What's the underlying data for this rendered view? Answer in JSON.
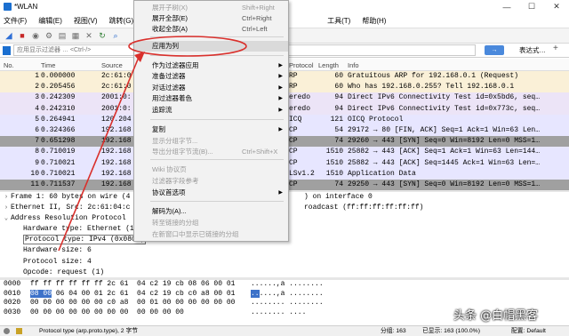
{
  "window": {
    "title": "*WLAN",
    "minimize": "—",
    "maximize": "☐",
    "close": "✕"
  },
  "menubar": [
    "文件(F)",
    "编辑(E)",
    "视图(V)",
    "跳转(G)",
    "工具(T)",
    "帮助(H)"
  ],
  "toolbar_icons": [
    "shark-fin-icon",
    "stop-icon",
    "restart-icon",
    "options-icon",
    "open-icon",
    "save-icon",
    "close-file-icon",
    "reload-icon",
    "search-icon"
  ],
  "filter": {
    "placeholder": "应用显示过滤器 … <Ctrl-/>",
    "expression_label": "表达式…",
    "plus": "+"
  },
  "packet_list": {
    "headers": {
      "no": "No.",
      "time": "Time",
      "source": "Source",
      "protocol": "Protocol",
      "length": "Length",
      "info": "Info"
    },
    "rows": [
      {
        "no": "1",
        "time": "0.000000",
        "src": "2c:61:0",
        "proto": "RP",
        "len": "60",
        "info": "Gratuitous ARP for 192.168.0.1 (Request)",
        "cls": "bg-arp"
      },
      {
        "no": "2",
        "time": "0.205456",
        "src": "2c:61:0",
        "proto": "RP",
        "len": "60",
        "info": "Who has 192.168.0.255? Tell 192.168.0.1",
        "cls": "bg-arp"
      },
      {
        "no": "3",
        "time": "0.242309",
        "src": "2001:0:",
        "proto": "eredo",
        "len": "94",
        "info": "Direct IPv6 Connectivity Test id=0x5bd6, seq…",
        "cls": "bg-teredo"
      },
      {
        "no": "4",
        "time": "0.242310",
        "src": "2001:0:",
        "proto": "eredo",
        "len": "94",
        "info": "Direct IPv6 Connectivity Test id=0x773c, seq…",
        "cls": "bg-teredo"
      },
      {
        "no": "5",
        "time": "0.264941",
        "src": "120.204",
        "proto": "ICQ",
        "len": "121",
        "info": "OICQ Protocol",
        "cls": "bg-oicq"
      },
      {
        "no": "6",
        "time": "0.324366",
        "src": "192.168",
        "proto": "CP",
        "len": "54",
        "info": "29172 → 80 [FIN, ACK] Seq=1 Ack=1 Win=63 Len…",
        "cls": "bg-tcp"
      },
      {
        "no": "7",
        "time": "0.651298",
        "src": "192.168",
        "proto": "CP",
        "len": "74",
        "info": "29260 → 443 [SYN] Seq=0 Win=8192 Len=0 MSS=1…",
        "cls": "bg-gray"
      },
      {
        "no": "8",
        "time": "0.710019",
        "src": "192.168",
        "proto": "CP",
        "len": "1510",
        "info": "25882 → 443 [ACK] Seq=1 Ack=1 Win=63 Len=144…",
        "cls": "bg-tcp"
      },
      {
        "no": "9",
        "time": "0.710021",
        "src": "192.168",
        "proto": "CP",
        "len": "1510",
        "info": "25882 → 443 [ACK] Seq=1445 Ack=1 Win=63 Len=…",
        "cls": "bg-tcp"
      },
      {
        "no": "10",
        "time": "0.710021",
        "src": "192.168",
        "proto": "LSv1.2",
        "len": "1510",
        "info": "Application Data",
        "cls": "bg-tcp"
      },
      {
        "no": "11",
        "time": "0.711537",
        "src": "192.168",
        "proto": "CP",
        "len": "74",
        "info": "29250 → 443 [SYN] Seq=0 Win=8192 Len=0 MSS=1…",
        "cls": "bg-darkgray"
      }
    ]
  },
  "detail": [
    {
      "text": "Frame 1: 60 bytes on wire (4",
      "tail": ") on interface 0",
      "arrow": "›",
      "level": "top"
    },
    {
      "text": "Ethernet II, Src: 2c:61:04:c",
      "tail": "roadcast (ff:ff:ff:ff:ff:ff)",
      "arrow": "›",
      "level": "top"
    },
    {
      "text": "Address Resolution Protocol",
      "tail": "",
      "arrow": "⌄",
      "level": "top"
    },
    {
      "text": "Hardware type: Ethernet (1",
      "tail": "",
      "level": "child"
    },
    {
      "text": "Protocol type: IPv4 (0x0800)",
      "tail": "",
      "level": "child",
      "hl": true
    },
    {
      "text": "Hardware size: 6",
      "tail": "",
      "level": "child"
    },
    {
      "text": "Protocol size: 4",
      "tail": "",
      "level": "child"
    },
    {
      "text": "Opcode: request (1)",
      "tail": "",
      "level": "child"
    }
  ],
  "bytes": [
    {
      "off": "0000",
      "hex": "ff ff ff ff ff ff 2c 61  04 c2 19 cb 08 06 00 01",
      "asc": "......,a ........"
    },
    {
      "off": "0010",
      "hex_sel": "08 00",
      "hex": " 06 04 00 01 2c 61  04 c2 19 cb c0 a8 00 01",
      "asc_sel": "..",
      "asc": "....,a ........"
    },
    {
      "off": "0020",
      "hex": "00 00 00 00 00 00 c0 a8  00 01 00 00 00 00 00 00",
      "asc": "........ ........"
    },
    {
      "off": "0030",
      "hex": "00 00 00 00 00 00 00 00  00 00 00 00",
      "asc": "........ ...."
    }
  ],
  "status": {
    "field": "Protocol type (arp.proto.type), 2 字节",
    "groups": "分组: 163",
    "shown": "已显示: 163 (100.0%)",
    "profile": "配置: Default"
  },
  "context_menu": {
    "items": [
      {
        "label": "展开子树(X)",
        "shortcut": "Shift+Right",
        "disabled": true
      },
      {
        "label": "展开全部(E)",
        "shortcut": "Ctrl+Right"
      },
      {
        "label": "收起全部(A)",
        "shortcut": "Ctrl+Left"
      },
      {
        "label": "应用为列",
        "shortcut": "",
        "hover": true
      },
      {
        "label": "作为过滤器应用",
        "submenu": true
      },
      {
        "label": "准备过滤器",
        "submenu": true
      },
      {
        "label": "对话过滤器",
        "submenu": true
      },
      {
        "label": "用过滤器着色",
        "submenu": true
      },
      {
        "label": "追踪流",
        "submenu": true
      },
      {
        "label": "复制",
        "submenu": true
      },
      {
        "label": "显示分组字节...",
        "disabled": true
      },
      {
        "label": "导出分组字节流(B)...",
        "shortcut": "Ctrl+Shift+X",
        "disabled": true
      },
      {
        "label": "Wiki 协议页",
        "disabled": true
      },
      {
        "label": "过滤器字段参考",
        "disabled": true
      },
      {
        "label": "协议首选项",
        "submenu": true
      },
      {
        "label": "解码为(A)..."
      },
      {
        "label": "转至链接的分组",
        "disabled": true
      },
      {
        "label": "在新窗口中显示已链接的分组",
        "disabled": true
      }
    ]
  },
  "watermark": "头条 @白帽黑客",
  "colors": {
    "selected_row": "#5a8fd8",
    "annotation": "#d9302c",
    "arp_row": "#faf0d7",
    "tcp_row": "#e7e6ff"
  }
}
